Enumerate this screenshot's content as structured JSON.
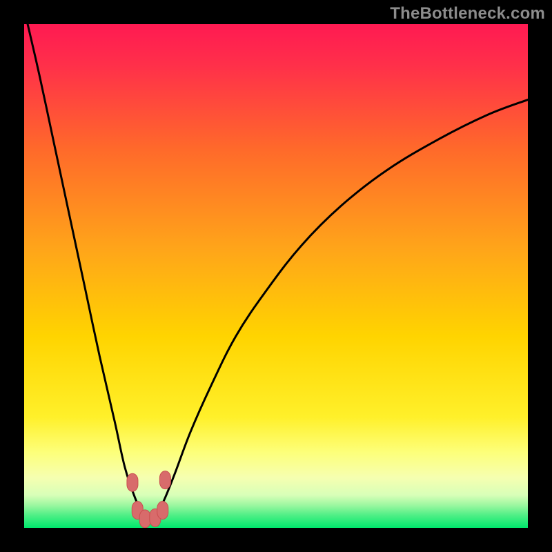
{
  "watermark": "TheBottleneck.com",
  "colors": {
    "frame": "#000000",
    "gradient_top": "#ff1a52",
    "gradient_mid1": "#ff7b00",
    "gradient_mid2": "#ffd400",
    "gradient_mid3": "#fff27a",
    "gradient_bottom": "#00e86c",
    "curve": "#000000",
    "marker_fill": "#d86b6b",
    "marker_stroke": "#c94f4f"
  },
  "chart_data": {
    "type": "line",
    "title": "",
    "xlabel": "",
    "ylabel": "",
    "xlim": [
      0,
      100
    ],
    "ylim": [
      0,
      100
    ],
    "series": [
      {
        "name": "bottleneck-curve",
        "x": [
          0,
          3,
          6,
          9,
          12,
          15,
          18,
          20,
          22,
          23.5,
          25,
          26.5,
          28,
          30,
          33,
          37,
          42,
          48,
          55,
          63,
          72,
          82,
          92,
          100
        ],
        "y": [
          103,
          90,
          76,
          62,
          48,
          34,
          21,
          12,
          6,
          3,
          1.5,
          3,
          6,
          11,
          19,
          28,
          38,
          47,
          56,
          64,
          71,
          77,
          82,
          85
        ]
      }
    ],
    "markers": [
      {
        "x": 21.5,
        "y": 9.0
      },
      {
        "x": 22.5,
        "y": 3.5
      },
      {
        "x": 24.0,
        "y": 1.8
      },
      {
        "x": 26.0,
        "y": 2.0
      },
      {
        "x": 27.5,
        "y": 3.5
      },
      {
        "x": 28.0,
        "y": 9.5
      }
    ],
    "annotations": []
  }
}
